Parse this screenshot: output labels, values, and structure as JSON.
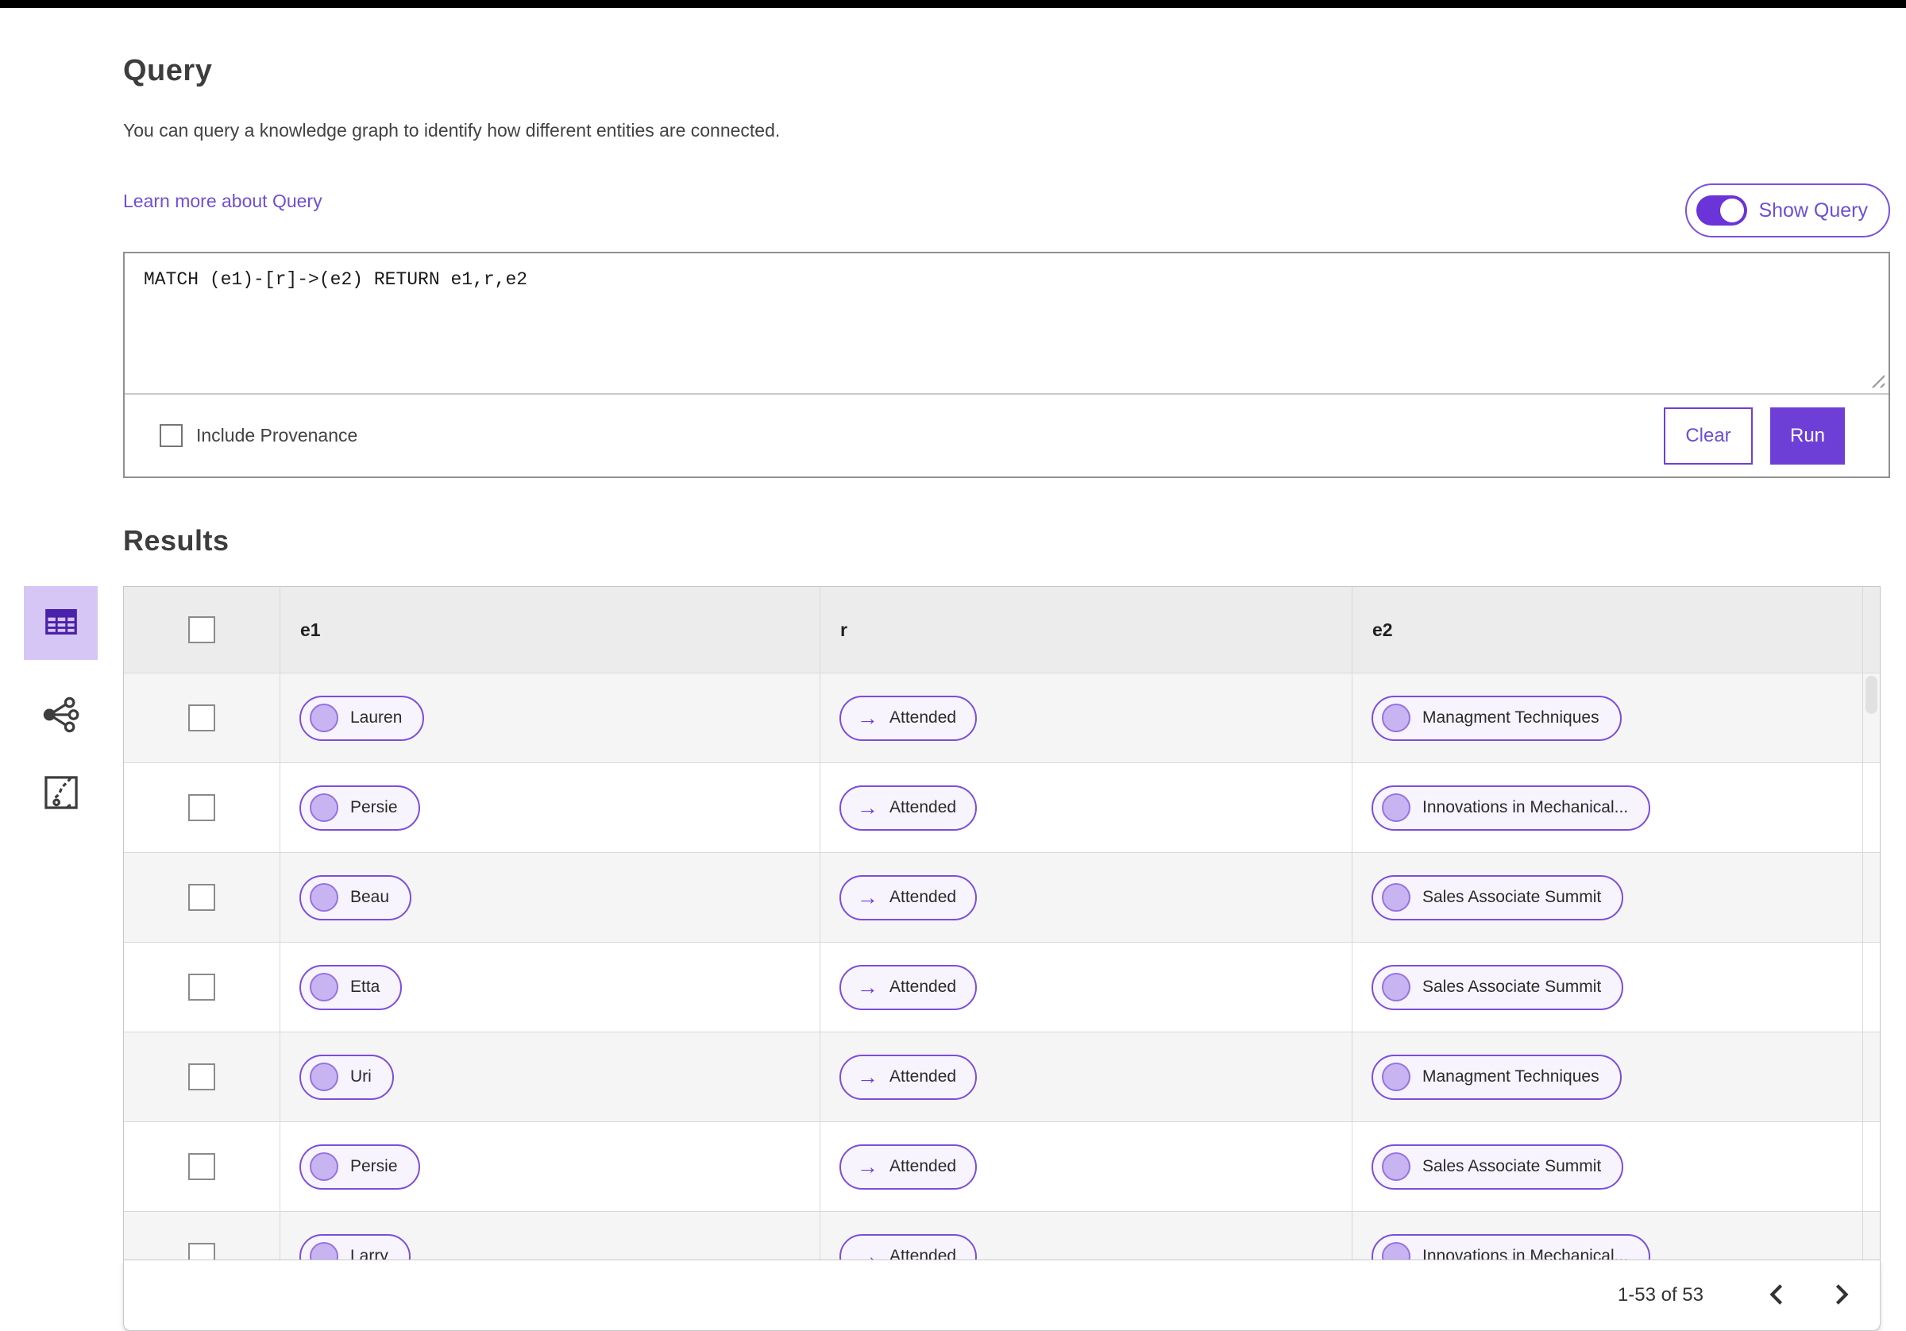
{
  "header": {
    "title": "Query",
    "description": "You can query a knowledge graph to identify how different entities are connected.",
    "learn_more": "Learn more about Query",
    "show_query_label": "Show Query",
    "show_query_on": true
  },
  "query_panel": {
    "query_text": "MATCH (e1)-[r]->(e2) RETURN e1,r,e2",
    "include_provenance_label": "Include Provenance",
    "include_provenance_checked": false,
    "clear_label": "Clear",
    "run_label": "Run"
  },
  "results": {
    "title": "Results",
    "view_rail": {
      "selected_view": "table",
      "icons": [
        "table-view-icon",
        "graph-view-icon",
        "map-view-icon"
      ]
    },
    "table": {
      "columns": [
        "e1",
        "r",
        "e2"
      ],
      "rows": [
        {
          "e1": "Lauren",
          "r": "Attended",
          "e2": "Managment Techniques"
        },
        {
          "e1": "Persie",
          "r": "Attended",
          "e2": "Innovations in Mechanical..."
        },
        {
          "e1": "Beau",
          "r": "Attended",
          "e2": "Sales Associate Summit"
        },
        {
          "e1": "Etta",
          "r": "Attended",
          "e2": "Sales Associate Summit"
        },
        {
          "e1": "Uri",
          "r": "Attended",
          "e2": "Managment Techniques"
        },
        {
          "e1": "Persie",
          "r": "Attended",
          "e2": "Sales Associate Summit"
        },
        {
          "e1": "Larry",
          "r": "Attended",
          "e2": "Innovations in Mechanical..."
        }
      ]
    },
    "pagination": {
      "range_text": "1-53 of 53",
      "prev_icon": "chevron-left-icon",
      "next_icon": "chevron-right-icon"
    }
  },
  "colors": {
    "primary_purple": "#6e3fd7",
    "toggle_purple": "#6a34d8",
    "link_purple": "#6e4fd6",
    "pill_border": "#7c4ddc",
    "pill_fill": "#f7f4fe",
    "pill_circle_fill": "#c9b4f2",
    "selected_view_bg": "#d6c6f5",
    "header_row_bg": "#ececec",
    "alt_row_bg": "#f5f5f5"
  }
}
